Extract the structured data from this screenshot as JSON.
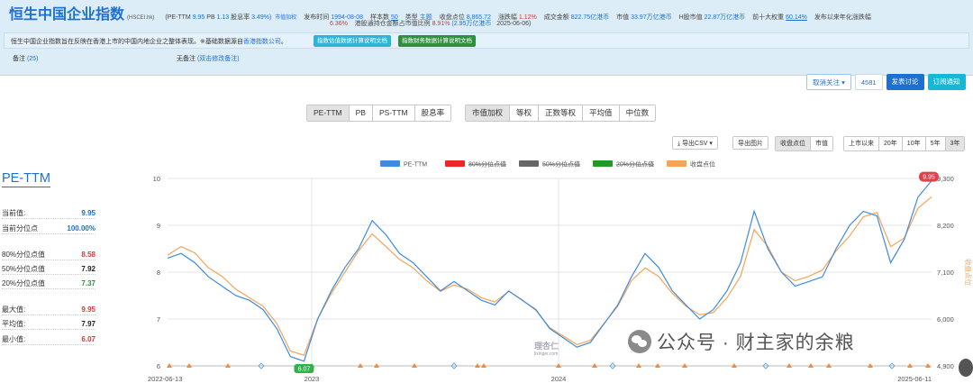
{
  "header": {
    "index_name": "恒生中国企业指数",
    "index_code": "(HSCEI.hk)",
    "pe_label": "(PE-TTM",
    "pe_value": "9.95",
    "pb_label": "PB",
    "pb_value": "1.13",
    "div_label": "股息率",
    "div_value": "3.49%)",
    "div_link": "市值加权",
    "release_label": "发布时间",
    "release_value": "1994-08-08",
    "sample_label": "样本数",
    "sample_value": "50",
    "type_label": "类型",
    "type_value": "主题",
    "close_label": "收盘点位",
    "close_value": "8,865.72",
    "change_label": "涨跌幅",
    "change_value": "1.12%",
    "turnover_label": "成交金额",
    "turnover_value": "822.75亿港币",
    "mktcap_label": "市值",
    "mktcap_value": "33.97万亿港币",
    "hshare_label": "H股市值",
    "hshare_value": "22.87万亿港币",
    "top10_label": "前十大权重",
    "top10_value": "60.14%",
    "ytd_label": "发布以来年化涨跌幅",
    "ytd_value": "6.36%",
    "connect_label": "港股通持仓金额占市值比例",
    "connect_value": "8.91%",
    "connect_amount": "(2.95万亿港币",
    "connect_date": "2025-06-06)",
    "description": "恒生中国企业指数旨在反映在香港上市的中国内地企业之整体表现。※基础数据源自",
    "description_link": "香港指数公司",
    "description_end": "。",
    "doc_btn1": "指数估值数据计算说明文档",
    "doc_btn2": "指数财务数据计算说明文档",
    "note_label": "备注",
    "note_count": "(25)",
    "noremark_label": "无备注",
    "noremark_link": "(双击修改备注)"
  },
  "follow": {
    "unfollow_label": "取消关注",
    "count": "4581",
    "discuss_label": "发表讨论",
    "subscribe_label": "订阅通知"
  },
  "tabs": {
    "metric": [
      "PE-TTM",
      "PB",
      "PS-TTM",
      "股息率"
    ],
    "weighting": [
      "市值加权",
      "等权",
      "正数等权",
      "平均值",
      "中位数"
    ]
  },
  "tools": {
    "export_csv": "导出CSV",
    "export_img": "导出图片",
    "overlay": [
      "收盘点位",
      "市值"
    ],
    "ranges": [
      "上市以来",
      "20年",
      "10年",
      "5年",
      "3年"
    ]
  },
  "stats": {
    "title": "PE-TTM",
    "rows": [
      {
        "label": "当前值:",
        "value": "9.95",
        "color": "blue"
      },
      {
        "label": "当前分位点",
        "value": "100.00%",
        "color": "blue"
      },
      {
        "label": "80%分位点值",
        "value": "8.58",
        "color": "red"
      },
      {
        "label": "50%分位点值",
        "value": "7.92",
        "color": "dark"
      },
      {
        "label": "20%分位点值",
        "value": "7.37",
        "color": "green"
      },
      {
        "label": "最大值:",
        "value": "9.95",
        "color": "red"
      },
      {
        "label": "平均值:",
        "value": "7.97",
        "color": "dark"
      },
      {
        "label": "最小值:",
        "value": "6.07",
        "color": "red"
      }
    ]
  },
  "chart_data": {
    "type": "line",
    "legend": [
      {
        "name": "PE-TTM",
        "color": "#3e8be0"
      },
      {
        "name": "80%分位点值",
        "color": "#e8262c"
      },
      {
        "name": "50%分位点值",
        "color": "#666666"
      },
      {
        "name": "20%分位点值",
        "color": "#1f9a2a"
      },
      {
        "name": "收盘点位",
        "color": "#f4a458"
      }
    ],
    "x_labels": [
      "2022-06-13",
      "2023",
      "2024",
      "2025-06-11"
    ],
    "y_left_ticks": [
      6,
      7,
      8,
      9,
      10
    ],
    "y_left_range": [
      6,
      10
    ],
    "y_right_ticks": [
      "4,900",
      "6,000",
      "7,100",
      "8,200",
      "9,300"
    ],
    "y_right_range": [
      4900,
      9300
    ],
    "y_right_label": "收盘点位",
    "max_label": "9.95",
    "min_label": "6.07",
    "pe_series": [
      8.3,
      8.4,
      8.2,
      7.9,
      7.7,
      7.5,
      7.4,
      7.2,
      6.8,
      6.2,
      6.1,
      7.0,
      7.6,
      8.1,
      8.5,
      9.1,
      8.8,
      8.4,
      8.2,
      7.9,
      7.6,
      7.8,
      7.6,
      7.4,
      7.3,
      7.6,
      7.4,
      7.2,
      6.8,
      6.6,
      6.4,
      6.5,
      6.9,
      7.3,
      7.9,
      8.4,
      8.1,
      7.6,
      7.3,
      7.0,
      7.2,
      7.6,
      8.2,
      9.3,
      8.5,
      8.0,
      7.7,
      7.8,
      7.9,
      8.5,
      9.0,
      9.3,
      9.2,
      8.2,
      8.7,
      9.6,
      9.95
    ],
    "close_series": [
      7500,
      7700,
      7550,
      7200,
      7000,
      6700,
      6500,
      6300,
      5900,
      5250,
      5150,
      6000,
      6600,
      7100,
      7600,
      8000,
      7700,
      7400,
      7200,
      6900,
      6650,
      6800,
      6700,
      6500,
      6400,
      6650,
      6450,
      6200,
      5800,
      5600,
      5400,
      5500,
      5900,
      6300,
      6900,
      7200,
      7000,
      6600,
      6300,
      6100,
      6150,
      6500,
      7000,
      8100,
      7700,
      7100,
      6900,
      7000,
      7150,
      7600,
      7950,
      8400,
      8500,
      7700,
      7900,
      8600,
      8866
    ]
  }
}
